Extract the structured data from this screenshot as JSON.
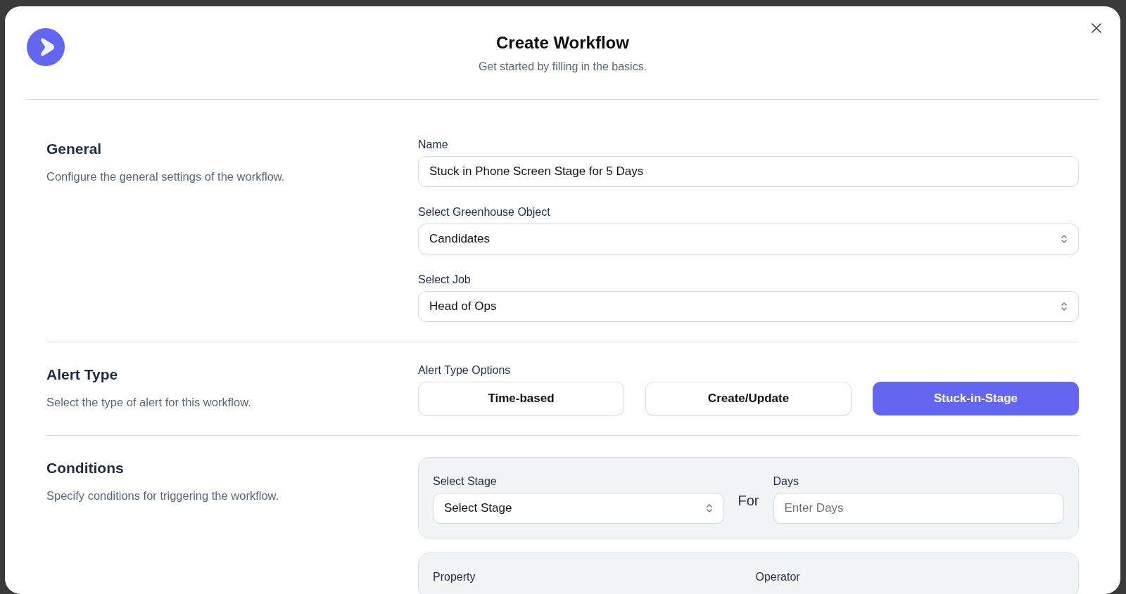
{
  "modal": {
    "title": "Create Workflow",
    "subtitle": "Get started by filling in the basics."
  },
  "sections": [
    {
      "heading": "General",
      "description": "Configure the general settings of the workflow.",
      "fields": [
        {
          "kind": "input",
          "label": "Name",
          "value": "Stuck in Phone Screen Stage for 5 Days"
        },
        {
          "kind": "select",
          "label": "Select Greenhouse Object",
          "value": "Candidates"
        },
        {
          "kind": "select",
          "label": "Select Job",
          "value": "Head of Ops"
        }
      ]
    },
    {
      "heading": "Alert Type",
      "description": "Select the type of alert for this workflow.",
      "fields": [
        {
          "kind": "options",
          "label": "Alert Type Options",
          "options": [
            {
              "label": "Time-based",
              "selected": false
            },
            {
              "label": "Create/Update",
              "selected": false
            },
            {
              "label": "Stuck-in-Stage",
              "selected": true
            }
          ]
        }
      ]
    },
    {
      "heading": "Conditions",
      "description": "Specify conditions for triggering the workflow.",
      "cards": [
        {
          "fields": [
            {
              "kind": "select",
              "label": "Select Stage",
              "value": "Select Stage"
            },
            {
              "kind": "connector",
              "text": "For"
            },
            {
              "kind": "input",
              "label": "Days",
              "placeholder": "Enter Days"
            }
          ]
        },
        {
          "fields": [
            {
              "kind": "label",
              "label": "Property"
            },
            {
              "kind": "label",
              "label": "Operator"
            }
          ]
        }
      ]
    }
  ]
}
